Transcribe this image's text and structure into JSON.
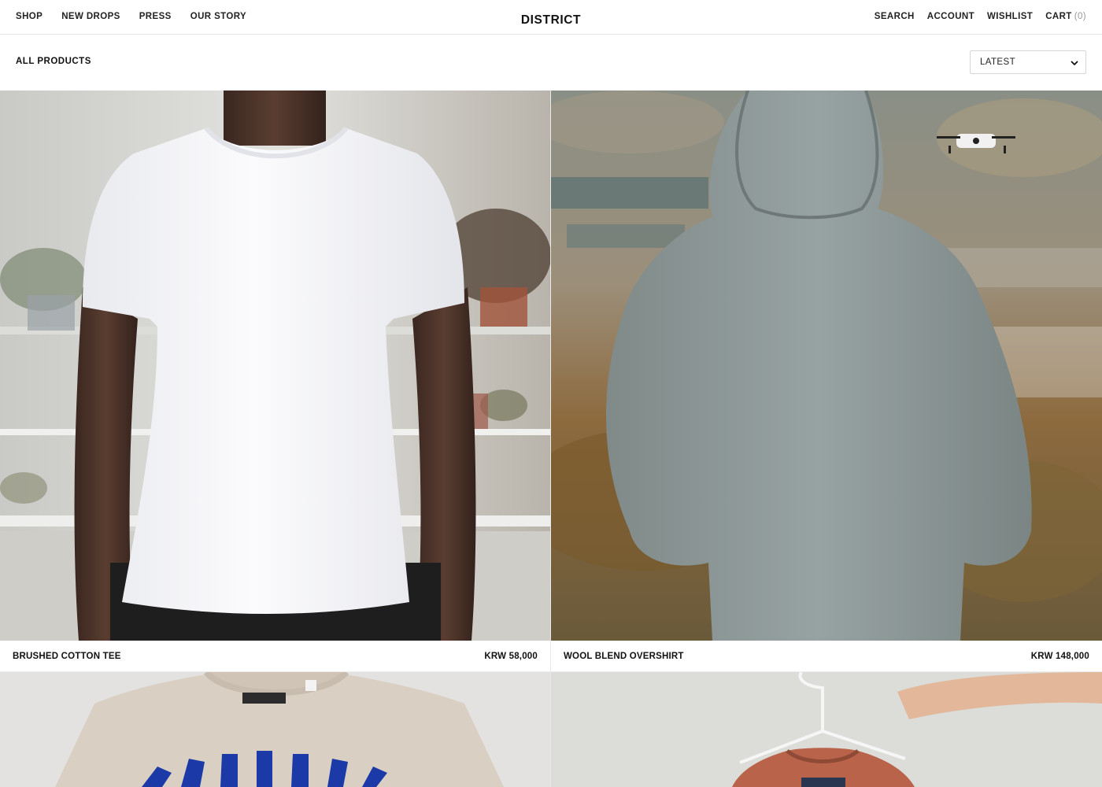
{
  "header": {
    "nav_left": [
      "SHOP",
      "NEW DROPS",
      "PRESS",
      "OUR STORY"
    ],
    "logo": "DISTRICT",
    "nav_right": {
      "search": "SEARCH",
      "account": "ACCOUNT",
      "wishlist": "WISHLIST",
      "cart": "CART",
      "cart_count": "(0)"
    }
  },
  "collection": {
    "title": "ALL PRODUCTS",
    "sort": {
      "selected": "LATEST",
      "icon": "chevron-down-icon"
    }
  },
  "products": [
    {
      "name": "BRUSHED COTTON TEE",
      "price": "KRW 58,000",
      "image": "white-tshirt-photo"
    },
    {
      "name": "WOOL BLEND OVERSHIRT",
      "price": "KRW 148,000",
      "image": "grey-hoodie-photo"
    },
    {
      "image": "beige-graphic-tee-photo"
    },
    {
      "image": "rust-shirt-on-hanger-photo"
    }
  ],
  "colors": {
    "text": "#111111",
    "muted": "#999999",
    "border": "#e6e6e6",
    "background": "#ffffff"
  }
}
